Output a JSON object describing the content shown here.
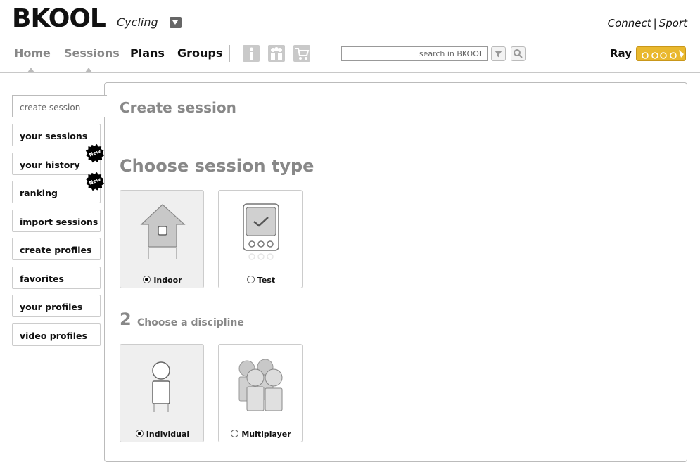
{
  "brand": {
    "logo": "BKOOL",
    "product": "Cycling"
  },
  "header": {
    "connect": "Connect",
    "sport": "Sport"
  },
  "nav": [
    {
      "label": "Home"
    },
    {
      "label": "Sessions"
    },
    {
      "label": "Plans"
    },
    {
      "label": "Groups"
    }
  ],
  "toolbar_icons": [
    "info-icon",
    "gift-icon",
    "cart-icon"
  ],
  "search": {
    "placeholder": "search in BKOOL",
    "filter_icon": "filter-icon",
    "magnifier_icon": "search-icon"
  },
  "user": {
    "name": "Ray",
    "badge_icon": "cycling-badge-icon"
  },
  "sidebar": {
    "active": "create session",
    "items": [
      {
        "label": "your sessions"
      },
      {
        "label": "your history",
        "badge": "New"
      },
      {
        "label": "ranking",
        "badge": "New"
      },
      {
        "label": "import sessions"
      },
      {
        "label": "create profiles"
      },
      {
        "label": "favorites"
      },
      {
        "label": "your profiles"
      },
      {
        "label": "video profiles"
      }
    ]
  },
  "main": {
    "title": "Create session",
    "step1": {
      "title": "Choose session type",
      "options": [
        {
          "label": "Indoor",
          "selected": true,
          "icon": "house-icon"
        },
        {
          "label": "Test",
          "selected": false,
          "icon": "device-check-icon"
        }
      ]
    },
    "step2": {
      "number": "2",
      "title": "Choose a discipline",
      "options": [
        {
          "label": "Individual",
          "selected": true,
          "icon": "person-icon"
        },
        {
          "label": "Multiplayer",
          "selected": false,
          "icon": "group-icon"
        }
      ]
    }
  },
  "colors": {
    "accent_badge": "#e9b82e",
    "muted_text": "#888888",
    "border": "#cccccc"
  }
}
